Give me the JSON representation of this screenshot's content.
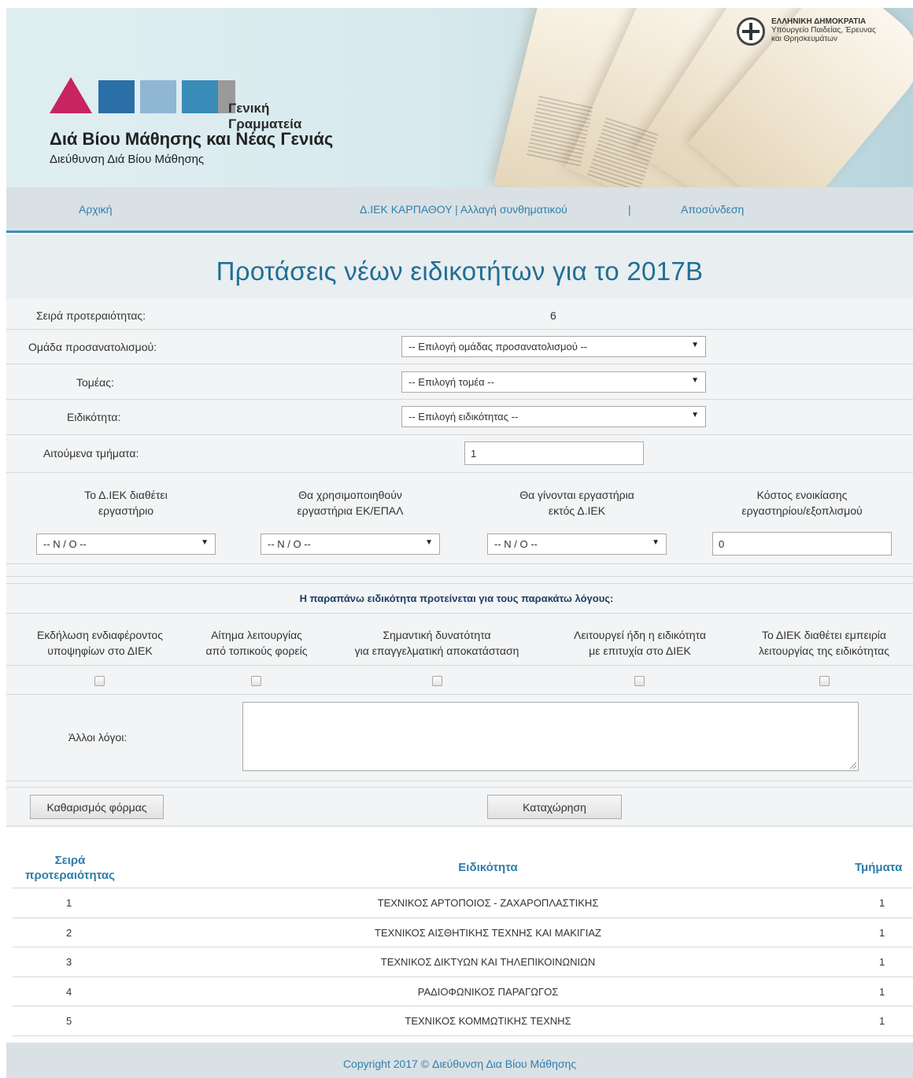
{
  "header": {
    "gov_line1": "ΕΛΛΗΝΙΚΗ ΔΗΜΟΚΡΑΤΙΑ",
    "gov_line2": "Υπουργείο Παιδείας, Έρευνας",
    "gov_line3": "και Θρησκευμάτων",
    "logo_tagline": "Γενική Γραμματεία",
    "logo_title": "Διά Βίου Μάθησης και Νέας Γενιάς",
    "logo_subtitle": "Διεύθυνση Διά Βίου Μάθησης",
    "logo_colors": [
      "#c8245f",
      "#2a6fa7",
      "#8fb7d4",
      "#3a8cb8",
      "#9a9a9a"
    ]
  },
  "nav": {
    "home": "Αρχική",
    "account": "Δ.ΙΕΚ ΚΑΡΠΑΘΟΥ | Αλλαγή συνθηματικού",
    "separator": "|",
    "logout": "Αποσύνδεση"
  },
  "page_title": "Προτάσεις νέων ειδικοτήτων για το 2017Β",
  "form": {
    "priority_label": "Σειρά προτεραιότητας:",
    "priority_value": "6",
    "orientation_label": "Ομάδα προσανατολισμού:",
    "orientation_select": "-- Επιλογή ομάδας προσανατολισμού --",
    "sector_label": "Τομέας:",
    "sector_select": "-- Επιλογή τομέα --",
    "specialty_label": "Ειδικότητα:",
    "specialty_select": "-- Επιλογή ειδικότητας --",
    "classes_label": "Αιτούμενα τμήματα:",
    "classes_value": "1",
    "lab_cols": [
      {
        "line1": "Το Δ.ΙΕΚ διαθέτει",
        "line2": "εργαστήριο",
        "value": "-- N / O --"
      },
      {
        "line1": "Θα χρησιμοποιηθούν",
        "line2": "εργαστήρια ΕΚ/ΕΠΑΛ",
        "value": "-- N / O --"
      },
      {
        "line1": "Θα γίνονται εργαστήρια",
        "line2": "εκτός Δ.ΙΕΚ",
        "value": "-- N / O --"
      },
      {
        "line1": "Κόστος ενοικίασης",
        "line2": "εργαστηρίου/εξοπλισμού",
        "value": "0"
      }
    ],
    "reasons_heading": "Η παραπάνω ειδικότητα προτείνεται για τους παρακάτω λόγους:",
    "reasons": [
      {
        "line1": "Εκδήλωση ενδιαφέροντος",
        "line2": "υποψηφίων στο ΔΙΕΚ",
        "checked": false
      },
      {
        "line1": "Αίτημα λειτουργίας",
        "line2": "από τοπικούς φορείς",
        "checked": false
      },
      {
        "line1": "Σημαντική δυνατότητα",
        "line2": "για επαγγελματική αποκατάσταση",
        "checked": false
      },
      {
        "line1": "Λειτουργεί ήδη η ειδικότητα",
        "line2": "με επιτυχία στο ΔΙΕΚ",
        "checked": false
      },
      {
        "line1": "Το ΔΙΕΚ διαθέτει εμπειρία",
        "line2": "λειτουργίας της ειδικότητας",
        "checked": false
      }
    ],
    "other_reasons_label": "Άλλοι λόγοι:",
    "other_reasons_value": "",
    "clear_button": "Καθαρισμός φόρμας",
    "submit_button": "Καταχώρηση"
  },
  "table": {
    "col_priority_line1": "Σειρά",
    "col_priority_line2": "προτεραιότητας",
    "col_specialty": "Ειδικότητα",
    "col_classes": "Τμήματα",
    "rows": [
      {
        "priority": "1",
        "specialty": "ΤΕΧΝΙΚΟΣ ΑΡΤΟΠΟΙΟΣ - ΖΑΧΑΡΟΠΛΑΣΤΙΚΗΣ",
        "classes": "1"
      },
      {
        "priority": "2",
        "specialty": "ΤΕΧΝΙΚΟΣ ΑΙΣΘΗΤΙΚΗΣ ΤΕΧΝΗΣ ΚΑΙ ΜΑΚΙΓΙΑΖ",
        "classes": "1"
      },
      {
        "priority": "3",
        "specialty": "ΤΕΧΝΙΚΟΣ ΔΙΚΤΥΩΝ ΚΑΙ ΤΗΛΕΠΙΚΟΙΝΩΝΙΩΝ",
        "classes": "1"
      },
      {
        "priority": "4",
        "specialty": "ΡΑΔΙΟΦΩΝΙΚΟΣ ΠΑΡΑΓΩΓΟΣ",
        "classes": "1"
      },
      {
        "priority": "5",
        "specialty": "ΤΕΧΝΙΚΟΣ ΚΟΜΜΩΤΙΚΗΣ ΤΕΧΝΗΣ",
        "classes": "1"
      }
    ]
  },
  "footer": "Copyright 2017 © Διεύθυνση Δια Βίου Μάθησης"
}
